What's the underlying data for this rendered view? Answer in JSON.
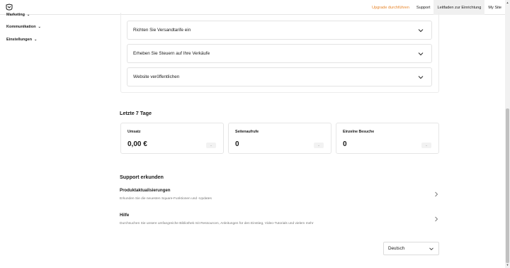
{
  "nav": {
    "upgrade": "Upgrade durchführen",
    "support": "Support",
    "guide": "Leitfaden zur Einrichtung",
    "site": "My Site"
  },
  "sidebar": {
    "items": [
      {
        "label": "Marketing"
      },
      {
        "label": "Kommunikation"
      },
      {
        "label": "Einstellungen"
      }
    ]
  },
  "setup": {
    "rows": [
      {
        "label": "Richten Sie Versandtarife ein"
      },
      {
        "label": "Erheben Sie Steuern auf Ihre Verkäufe"
      },
      {
        "label": "Website veröffentlichen"
      }
    ]
  },
  "stats": {
    "title": "Letzte 7 Tage",
    "cards": [
      {
        "label": "Umsatz",
        "value": "0,00 €",
        "trend": "-"
      },
      {
        "label": "Seitenaufrufe",
        "value": "0",
        "trend": "-"
      },
      {
        "label": "Einzelne Besuche",
        "value": "0",
        "trend": "-"
      }
    ]
  },
  "support": {
    "title": "Support erkunden",
    "items": [
      {
        "title": "Produktaktualisierungen",
        "desc": "Erkunden Sie die neuesten Square-Funktionen und -Updates"
      },
      {
        "title": "Hilfe",
        "desc": "Durchsuchen Sie unsere umfangreiche Bibliothek mit Ressourcen, Anleitungen für den Einstieg, Video-Tutorials und vielem mehr"
      }
    ]
  },
  "language": {
    "selected": "Deutsch"
  },
  "colors": {
    "accent": "#e8862b"
  },
  "icons": {
    "logo": "square-logo-icon",
    "expand": "chevron-down-icon",
    "forward": "chevron-right-icon"
  }
}
